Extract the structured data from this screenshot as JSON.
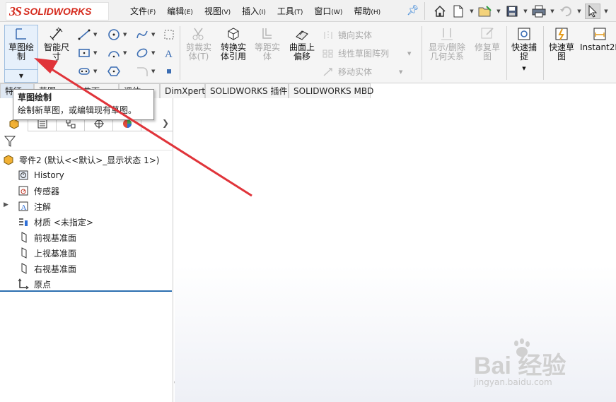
{
  "app": {
    "logo_mark": "3S",
    "logo_text": "SOLIDWORKS"
  },
  "menu": [
    {
      "label": "文件",
      "key": "(F)"
    },
    {
      "label": "编辑",
      "key": "(E)"
    },
    {
      "label": "视图",
      "key": "(V)"
    },
    {
      "label": "插入",
      "key": "(I)"
    },
    {
      "label": "工具",
      "key": "(T)"
    },
    {
      "label": "窗口",
      "key": "(W)"
    },
    {
      "label": "帮助",
      "key": "(H)"
    }
  ],
  "quick_access": [
    "home-icon",
    "new-document-icon",
    "open-icon",
    "save-icon",
    "print-icon",
    "undo-icon",
    "select-cursor-icon"
  ],
  "commands": {
    "sketch": "草图绘\n制",
    "smart_dim": "智能尺\n寸",
    "trim": "剪裁实\n体(T)",
    "convert": "转换实\n体引用",
    "offset": "等距实\n体",
    "surface_offset": "曲面上\n偏移",
    "mirror": "镜向实体",
    "linear_pattern": "线性草图阵列",
    "move": "移动实体",
    "display_relations": "显示/删除\n几何关系",
    "repair": "修复草\n图",
    "quick_snap": "快速捕\n捉",
    "rapid_sketch": "快速草\n图",
    "instant2d": "Instant2D"
  },
  "tabs": [
    "特征",
    "草图",
    "曲面",
    "评估",
    "DimXpert",
    "SOLIDWORKS 插件",
    "SOLIDWORKS MBD"
  ],
  "tooltip": {
    "title": "草图绘制",
    "desc": "绘制新草图，或编辑现有草图。"
  },
  "tree": {
    "root": "零件2 (默认<<默认>_显示状态 1>)",
    "items": [
      {
        "name": "history",
        "label": "History",
        "icon": "history-icon"
      },
      {
        "name": "sensors",
        "label": "传感器",
        "icon": "sensor-icon"
      },
      {
        "name": "annotations",
        "label": "注解",
        "icon": "annotation-icon"
      },
      {
        "name": "material",
        "label": "材质 <未指定>",
        "icon": "material-icon"
      },
      {
        "name": "front-plane",
        "label": "前视基准面",
        "icon": "plane-icon"
      },
      {
        "name": "top-plane",
        "label": "上视基准面",
        "icon": "plane-icon"
      },
      {
        "name": "right-plane",
        "label": "右视基准面",
        "icon": "plane-icon"
      },
      {
        "name": "origin",
        "label": "原点",
        "icon": "origin-icon"
      }
    ]
  },
  "watermark": {
    "main": "Bai 经验",
    "sub": "jingyan.baidu.com"
  },
  "colors": {
    "brand": "#d52b1e",
    "arrow": "#e0343a",
    "accent": "#2f7fd6"
  }
}
